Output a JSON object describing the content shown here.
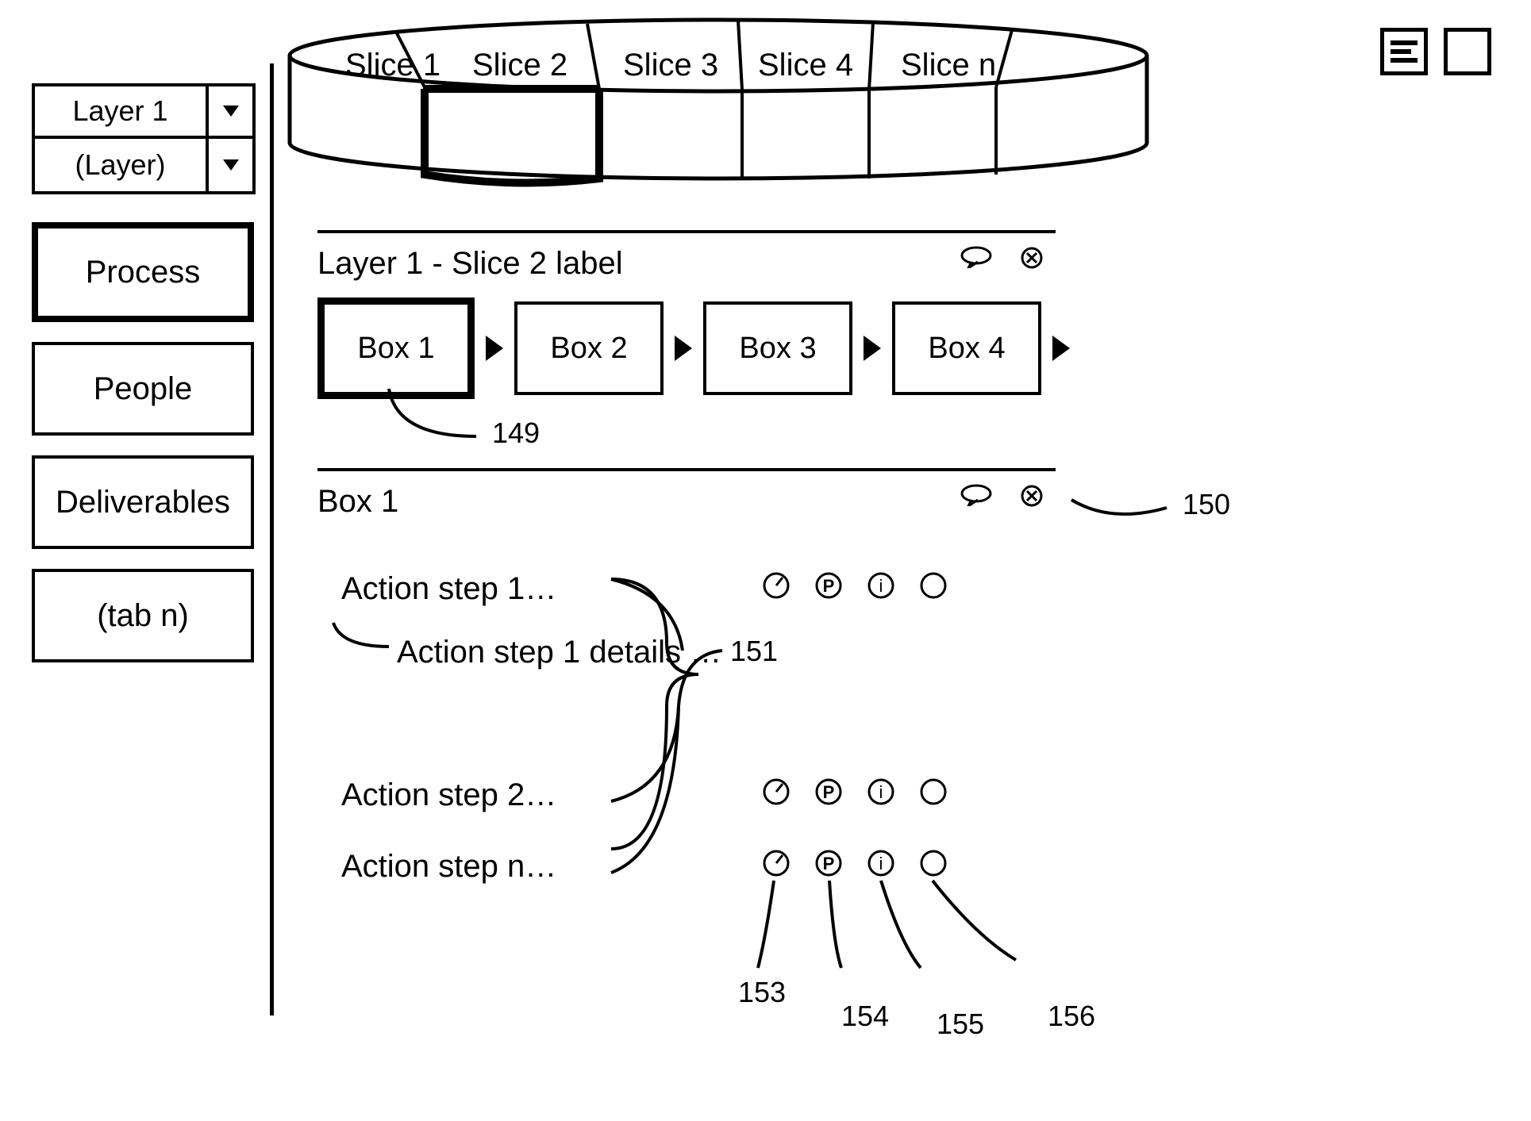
{
  "layers": [
    {
      "name": "Layer 1"
    },
    {
      "name": "(Layer)"
    }
  ],
  "tabs": [
    {
      "label": "Process",
      "selected": true
    },
    {
      "label": "People",
      "selected": false
    },
    {
      "label": "Deliverables",
      "selected": false
    },
    {
      "label": "(tab n)",
      "selected": false
    }
  ],
  "slices": [
    "Slice 1",
    "Slice 2",
    "Slice 3",
    "Slice 4",
    "Slice n"
  ],
  "selected_slice_index": 1,
  "breadcrumb": "Layer 1  -   Slice 2 label",
  "boxes": [
    "Box 1",
    "Box 2",
    "Box 3",
    "Box 4"
  ],
  "selected_box_index": 0,
  "box_section_title": "Box 1",
  "actions": [
    {
      "label": "Action step 1…",
      "detail": "Action step 1 details …",
      "icons": true
    },
    {
      "label": "Action step 2…",
      "icons": true
    },
    {
      "label": "Action step n…",
      "icons": true
    }
  ],
  "refs": {
    "box1": "149",
    "box_panel": "150",
    "actions_group": "151",
    "icon1": "153",
    "icon2": "154",
    "icon3": "155",
    "icon4": "156"
  }
}
